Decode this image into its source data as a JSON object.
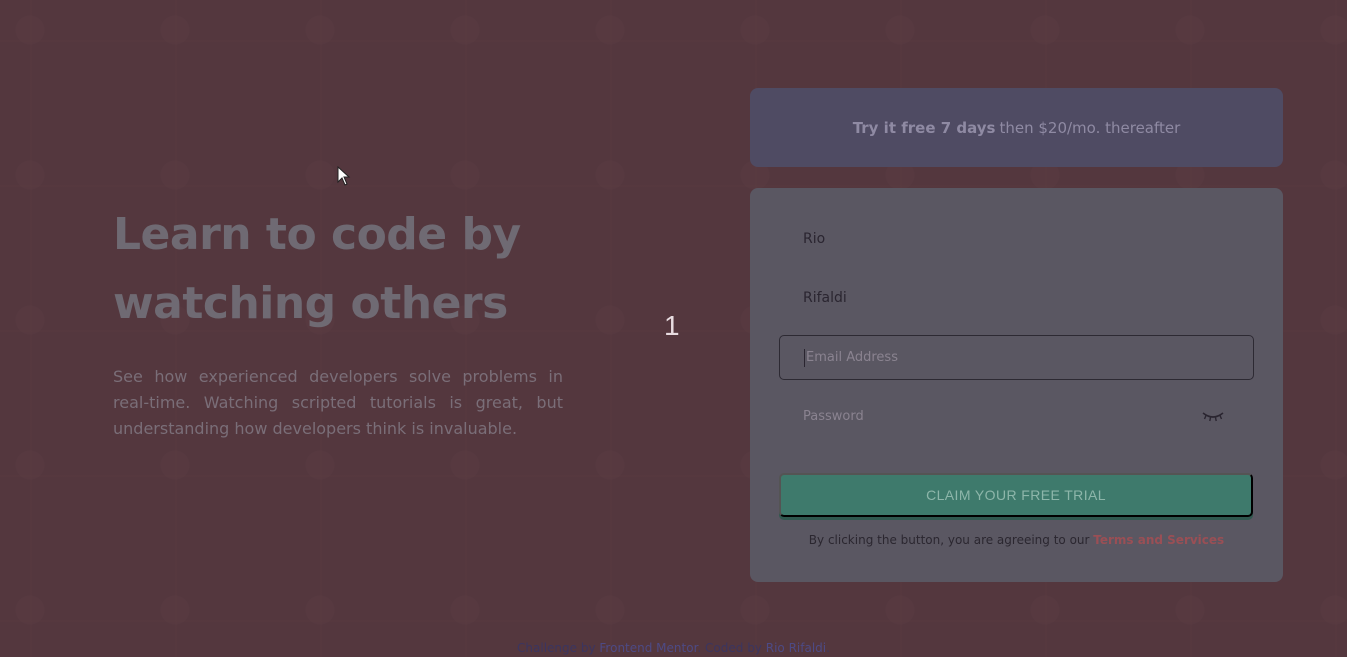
{
  "hero": {
    "title_line1": "Learn to code by",
    "title_line2": "watching others",
    "description": "See how experienced developers solve problems in real-time. Watching scripted tutorials is great, but understanding how developers think is invaluable."
  },
  "step_number": "1",
  "promo": {
    "bold": "Try it free 7 days",
    "rest": "then $20/mo. thereafter"
  },
  "form": {
    "first_name": "Rio",
    "last_name": "Rifaldi",
    "email_placeholder": "Email Address",
    "password_placeholder": "Password",
    "password_toggle_icon": "eye-closed-icon",
    "submit_label": "CLAIM YOUR FREE TRIAL",
    "terms_prefix": "By clicking the button, you are agreeing to our",
    "terms_link": "Terms and Services"
  },
  "attribution": {
    "prefix": "Challenge by",
    "frontend_mentor": "Frontend Mentor",
    "middle": ". Coded by",
    "author": "Rio Rifaldi",
    "suffix": "."
  },
  "colors": {
    "background": "#5b3a42",
    "promo": "#4f4b63",
    "card": "#5a5762",
    "cta": "#3e7a6c",
    "terms_link": "#9a4f55"
  }
}
